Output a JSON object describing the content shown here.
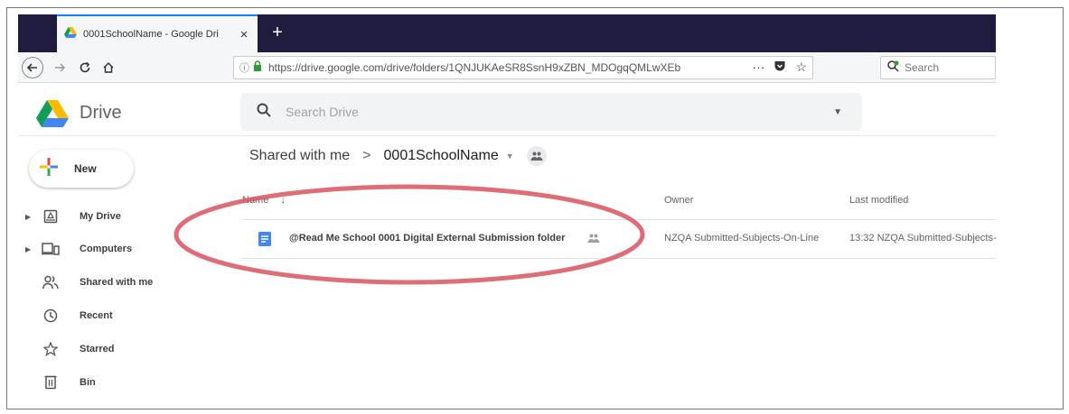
{
  "browser": {
    "tab_title": "0001SchoolName - Google Dri",
    "tab_close": "×",
    "new_tab": "+",
    "url": "https://drive.google.com/drive/folders/1QNJUKAeSR8SsnH9xZBN_MDOgqQMLwXEb",
    "url_more": "···",
    "search_placeholder": "Search"
  },
  "drive": {
    "brand": "Drive",
    "search_placeholder": "Search Drive"
  },
  "sidebar": {
    "new_label": "New",
    "items": [
      {
        "label": "My Drive",
        "icon": "my-drive-icon",
        "expandable": true
      },
      {
        "label": "Computers",
        "icon": "computers-icon",
        "expandable": true
      },
      {
        "label": "Shared with me",
        "icon": "shared-with-me-icon",
        "expandable": false
      },
      {
        "label": "Recent",
        "icon": "clock-icon",
        "expandable": false
      },
      {
        "label": "Starred",
        "icon": "star-icon",
        "expandable": false
      },
      {
        "label": "Bin",
        "icon": "trash-icon",
        "expandable": false
      }
    ]
  },
  "breadcrumb": {
    "root": "Shared with me",
    "separator": ">",
    "current": "0001SchoolName"
  },
  "columns": {
    "name": "Name",
    "sort_arrow": "↓",
    "owner": "Owner",
    "last_modified": "Last modified"
  },
  "files": [
    {
      "name": "@Read Me School 0001 Digital External Submission folder",
      "owner": "NZQA Submitted-Subjects-On-Line",
      "modified": "13:32 NZQA Submitted-Subjects-",
      "type": "document",
      "shared": true
    }
  ],
  "colors": {
    "tab_strip": "#1f1c3f",
    "doc_icon": "#4285f4",
    "annotation": "#d9535f",
    "lock": "#2e9c2e"
  }
}
